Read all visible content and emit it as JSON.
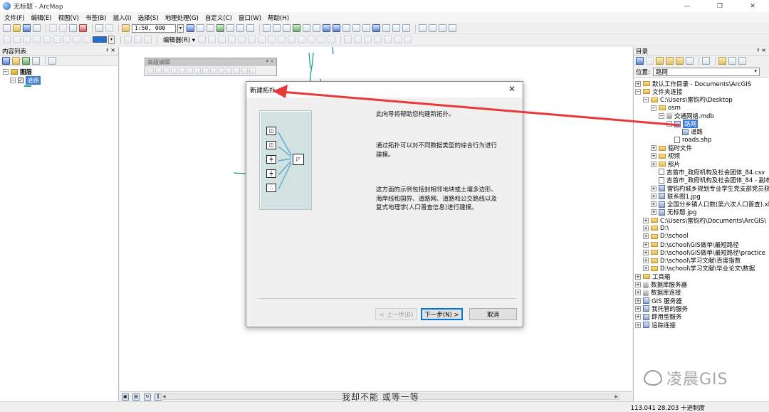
{
  "window": {
    "title": "无标题 - ArcMap",
    "controls": [
      "—",
      "❐",
      "✕"
    ]
  },
  "menu": [
    "文件(F)",
    "编辑(E)",
    "视图(V)",
    "书签(B)",
    "插入(I)",
    "选择(S)",
    "地理处理(G)",
    "自定义(C)",
    "窗口(W)",
    "帮助(H)"
  ],
  "toolbar": {
    "scale": "1:50, 000",
    "editor_label": "编辑器(R) ▾",
    "brand_color": "#1e6fd9"
  },
  "toc": {
    "title": "内容列表",
    "pin": "♯ ×",
    "layers_label": "图层",
    "layer_name": "道路",
    "legend_color": "#1a9e8f"
  },
  "advanced_editing": {
    "title": "高级编辑"
  },
  "dialog": {
    "title": "新建拓扑",
    "close": "✕",
    "paragraph1": "此向导将帮助您构建新拓扑。",
    "paragraph2": "通过拓扑可以对不同数据类型的综合行为进行建模。",
    "paragraph3": "这方面的示例包括封相邻地块或土壤多边形、海岸线和国界、道路网、道路和公交路线以及复式地理学(人口普查信息)进行建模。",
    "buttons": {
      "back": "< 上一步(B)",
      "next": "下一步(N) >",
      "cancel": "取消"
    }
  },
  "catalog": {
    "title": "目录",
    "location_label": "位置:",
    "location_value": "路网",
    "tree": {
      "default_dir": "默认工作目录 - Documents\\ArcGIS",
      "folder_connections": "文件夹连接",
      "desktop": "C:\\Users\\雷钧杓\\Desktop",
      "osm": "osm",
      "mdb": "交通网络.mdb",
      "dataset": "路网",
      "feature_class": "道路",
      "shp": "roads.shp",
      "temp": "临时文件",
      "video": "视频",
      "photos": "照片",
      "csv": "吉首市_政府机构及社会团体_84.csv",
      "csv_copy": "吉首市_政府机构及社会团体_84 - 副本",
      "xls1": "雷钧杓城乡规划专业学生党支部党员获",
      "jpg1": "联系图1.jpg",
      "xls2": "全国分乡镇人口数(第六次人口普查).xl",
      "jpg2": "无标题.jpg",
      "documents": "C:\\Users\\雷钧杓\\Documents\\ArcGIS\\",
      "d_root": "D:\\",
      "d_school": "D:\\school",
      "d_gis1": "D:\\school\\GIS做单\\最短路径",
      "d_gis2": "D:\\school\\GIS做单\\最短路径\\practice",
      "d_baidu": "D:\\school\\学习文献\\百度指数",
      "d_thesis": "D:\\school\\学习文献\\毕业论文\\数据",
      "toolbox": "工具箱",
      "db_servers": "数据库服务器",
      "db_conn": "数据库连接",
      "gis_servers": "GIS 服务器",
      "my_services": "我托管的服务",
      "ready_services": "即用型服务",
      "tracking": "追踪连接"
    }
  },
  "status": {
    "coords": "113.041  28.203 十进制度"
  },
  "overlay": {
    "subtitle": "我却不能 或等一等",
    "watermark": "凌晨GIS",
    "arrow_color": "#e8383a",
    "road_color": "#1a9e8f"
  }
}
